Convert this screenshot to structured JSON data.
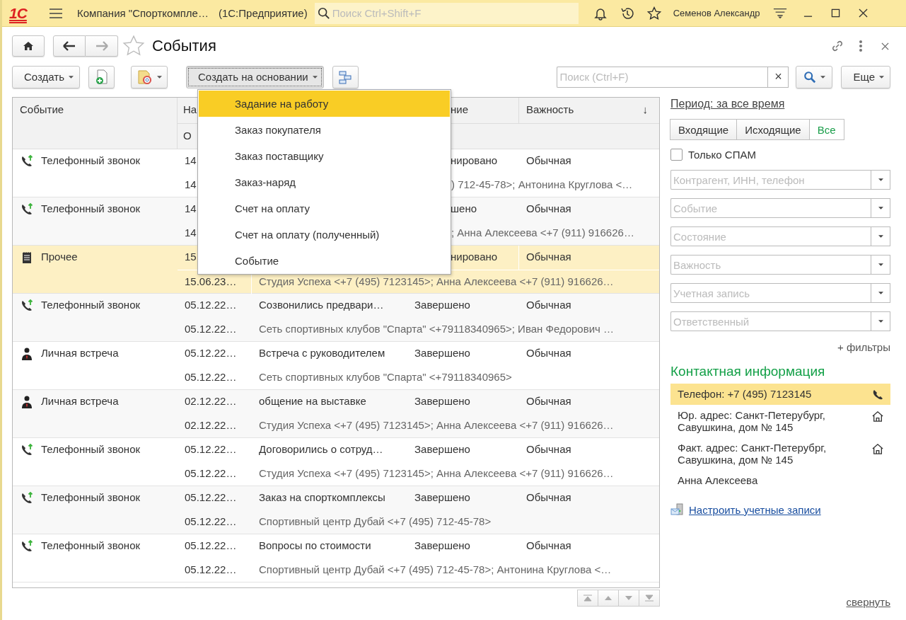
{
  "app_bar": {
    "logo": "1С",
    "title": "Компания \"Спорткомпле…",
    "product": "(1С:Предприятие)",
    "search_placeholder": "Поиск Ctrl+Shift+F",
    "user": "Семенов Александр"
  },
  "form": {
    "title": "События",
    "favorite": false
  },
  "toolbar": {
    "create": "Создать",
    "create_based_on": "Создать на основании",
    "search_placeholder": "Поиск (Ctrl+F)",
    "clear": "×",
    "more": "Еще"
  },
  "menu": {
    "items": [
      {
        "label": "Задание на работу",
        "selected": true
      },
      {
        "label": "Заказ покупателя",
        "selected": false
      },
      {
        "label": "Заказ поставщику",
        "selected": false
      },
      {
        "label": "Заказ-наряд",
        "selected": false
      },
      {
        "label": "Счет на оплату",
        "selected": false
      },
      {
        "label": "Счет на оплату (полученный)",
        "selected": false
      },
      {
        "label": "Событие",
        "selected": false
      }
    ]
  },
  "table": {
    "columns": [
      {
        "label": "Событие"
      },
      {
        "label": "На"
      },
      {
        "label": "ние",
        "covered": true
      },
      {
        "label": "Важность",
        "sort_mark": "↓"
      }
    ],
    "subheader": "О",
    "rows": [
      {
        "kind": "call",
        "event": "Телефонный звонок",
        "date": "14",
        "status": "нировано",
        "importance": "Обычная",
        "date2": "14",
        "contact": ") 712-45-78>; Антонина Круглова <…",
        "covered_top": true,
        "covered_bottom": true,
        "selected": false
      },
      {
        "kind": "call",
        "event": "Телефонный звонок",
        "date": "14",
        "status": "шено",
        "importance": "Обычная",
        "date2": "14",
        "contact": "; Анна Алексеева <+7 (911) 916626…",
        "covered_top": true,
        "covered_bottom": true,
        "selected": false
      },
      {
        "kind": "other",
        "event": "Прочее",
        "date": "15",
        "status": "нировано",
        "importance": "Обычная",
        "date2": "15.06.23…",
        "contact": "Студия Успеха <+7 (495) 7123145>; Анна Алексеева <+7 (911) 916626…",
        "covered_top": true,
        "covered_bottom": false,
        "selected": true
      },
      {
        "kind": "call",
        "event": "Телефонный звонок",
        "date": "05.12.22…",
        "subject": "Созвонились предвари…",
        "status": "Завершено",
        "importance": "Обычная",
        "date2": "05.12.22…",
        "contact": "Сеть спортивных клубов \"Спарта\" <+79118340965>; Иван Федорович …",
        "selected": false
      },
      {
        "kind": "meeting",
        "event": "Личная встреча",
        "date": "05.12.22…",
        "subject": "Встреча с руководителем",
        "status": "Завершено",
        "importance": "Обычная",
        "date2": "05.12.22…",
        "contact": "Сеть спортивных клубов \"Спарта\" <+79118340965>",
        "selected": false
      },
      {
        "kind": "meeting",
        "event": "Личная встреча",
        "date": "02.12.22…",
        "subject": "общение на выставке",
        "status": "Завершено",
        "importance": "Обычная",
        "date2": "02.12.22…",
        "contact": "Студия Успеха <+7 (495) 7123145>; Анна Алексеева <+7 (911) 916626…",
        "selected": false
      },
      {
        "kind": "call",
        "event": "Телефонный звонок",
        "date": "05.12.22…",
        "subject": "Договорились о сотруд…",
        "status": "Завершено",
        "importance": "Обычная",
        "date2": "05.12.22…",
        "contact": "Студия Успеха <+7 (495) 7123145>; Анна Алексеева <+7 (911) 916626…",
        "selected": false
      },
      {
        "kind": "call",
        "event": "Телефонный звонок",
        "date": "05.12.22…",
        "subject": "Заказ на спорткомплексы",
        "status": "Завершено",
        "importance": "Обычная",
        "date2": "05.12.22…",
        "contact": "Спортивный центр Дубай <+7 (495) 712-45-78>",
        "selected": false
      },
      {
        "kind": "call",
        "event": "Телефонный звонок",
        "date": "05.12.22…",
        "subject": "Вопросы по стоимости",
        "status": "Завершено",
        "importance": "Обычная",
        "date2": "05.12.22…",
        "contact": "Спортивный центр Дубай <+7 (495) 712-45-78>; Антонина Круглова <…",
        "selected": false
      }
    ]
  },
  "sidebar": {
    "period": "Период: за все время",
    "direction": [
      {
        "label": "Входящие",
        "selected": false
      },
      {
        "label": "Исходящие",
        "selected": false
      },
      {
        "label": "Все",
        "selected": true
      }
    ],
    "spam": {
      "label": "Только СПАМ",
      "checked": false
    },
    "filters": [
      {
        "placeholder": "Контрагент, ИНН, телефон"
      },
      {
        "placeholder": "Событие"
      },
      {
        "placeholder": "Состояние"
      },
      {
        "placeholder": "Важность"
      },
      {
        "placeholder": "Учетная запись"
      },
      {
        "placeholder": "Ответственный"
      }
    ],
    "more_filters": "+ фильтры",
    "contact_heading": "Контактная информация",
    "contacts": [
      {
        "kind": "phone",
        "text": "Телефон: +7 (495) 7123145",
        "selected": true
      },
      {
        "kind": "address",
        "text": "Юр. адрес: Санкт-Петерубург, Савушкина, дом № 145",
        "selected": false
      },
      {
        "kind": "address",
        "text": "Факт. адрес: Санкт-Петерубрг, Савушкина, дом № 145",
        "selected": false
      },
      {
        "kind": "person",
        "text": "Анна Алексеева",
        "selected": false
      }
    ],
    "accounts_link": "Настроить учетные записи",
    "collapse": "свернуть"
  }
}
